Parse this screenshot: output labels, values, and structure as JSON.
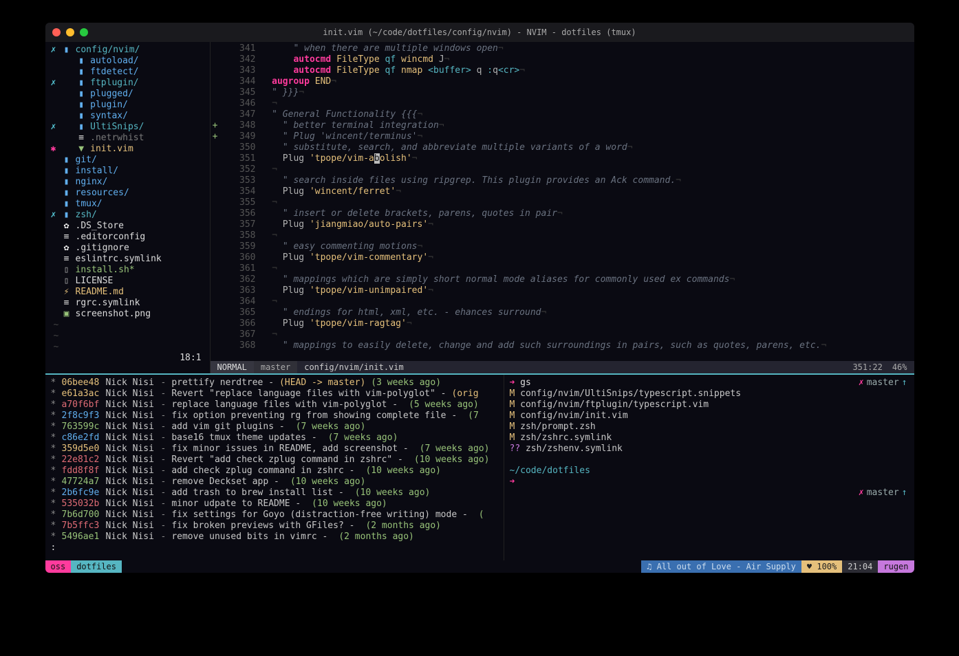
{
  "window": {
    "title": "init.vim (~/code/dotfiles/config/nvim) - NVIM - dotfiles (tmux)"
  },
  "tree": {
    "items": [
      {
        "mark": "✗",
        "icon": "folder",
        "name": "config/nvim/",
        "cls": "cyan"
      },
      {
        "mark": "",
        "icon": "folder",
        "name": "autoload/",
        "cls": "blue"
      },
      {
        "mark": "",
        "icon": "folder",
        "name": "ftdetect/",
        "cls": "blue"
      },
      {
        "mark": "✗",
        "icon": "folder",
        "name": "ftplugin/",
        "cls": "cyan"
      },
      {
        "mark": "",
        "icon": "folder",
        "name": "plugged/",
        "cls": "blue"
      },
      {
        "mark": "",
        "icon": "folder",
        "name": "plugin/",
        "cls": "blue"
      },
      {
        "mark": "",
        "icon": "folder",
        "name": "syntax/",
        "cls": "blue"
      },
      {
        "mark": "✗",
        "icon": "folder",
        "name": "UltiSnips/",
        "cls": "cyan"
      },
      {
        "mark": "",
        "icon": "doc",
        "name": ".netrwhist",
        "cls": "grey"
      },
      {
        "mark": "✱",
        "icon": "vim",
        "name": "init.vim",
        "cls": "yel"
      },
      {
        "mark": "",
        "icon": "folder",
        "name": "git/",
        "cls": "blue"
      },
      {
        "mark": "",
        "icon": "folder",
        "name": "install/",
        "cls": "blue"
      },
      {
        "mark": "",
        "icon": "folder",
        "name": "nginx/",
        "cls": "blue"
      },
      {
        "mark": "",
        "icon": "folder",
        "name": "resources/",
        "cls": "blue"
      },
      {
        "mark": "",
        "icon": "folder",
        "name": "tmux/",
        "cls": "blue"
      },
      {
        "mark": "✗",
        "icon": "folder",
        "name": "zsh/",
        "cls": "cyan"
      },
      {
        "mark": "",
        "icon": "gear",
        "name": ".DS_Store",
        "cls": "wh"
      },
      {
        "mark": "",
        "icon": "doc",
        "name": ".editorconfig",
        "cls": "wh"
      },
      {
        "mark": "",
        "icon": "gear",
        "name": ".gitignore",
        "cls": "wh"
      },
      {
        "mark": "",
        "icon": "doc",
        "name": "eslintrc.symlink",
        "cls": "wh"
      },
      {
        "mark": "",
        "icon": "file",
        "name": "install.sh*",
        "cls": "grn"
      },
      {
        "mark": "",
        "icon": "file",
        "name": "LICENSE",
        "cls": "wh"
      },
      {
        "mark": "",
        "icon": "bolt",
        "name": "README.md",
        "cls": "yel"
      },
      {
        "mark": "",
        "icon": "doc",
        "name": "rgrc.symlink",
        "cls": "wh"
      },
      {
        "mark": "",
        "icon": "img",
        "name": "screenshot.png",
        "cls": "wh"
      }
    ],
    "status": "18:1"
  },
  "code": {
    "lines": [
      {
        "n": 341,
        "html": "    <span class='cmt'>\" when there are multiple windows open</span><span class='eol'>¬</span>"
      },
      {
        "n": 342,
        "html": "    <span class='kw'>autocmd</span> <span class='fn'>FileType</span> <span class='type'>qf</span> <span class='fn'>wincmd</span> J<span class='eol'>¬</span>"
      },
      {
        "n": 343,
        "html": "    <span class='kw'>autocmd</span> <span class='fn'>FileType</span> <span class='type'>qf</span> <span class='fn'>nmap</span> <span class='ang'>&lt;buffer&gt;</span> q <span class='op'>:</span>q<span class='ang'>&lt;cr&gt;</span><span class='eol'>¬</span>"
      },
      {
        "n": 344,
        "html": "<span class='kw'>augroup</span> <span class='fn'>END</span><span class='eol'>¬</span>"
      },
      {
        "n": 345,
        "html": "<span class='cmt'>\" }}}</span><span class='eol'>¬</span>"
      },
      {
        "n": 346,
        "html": "<span class='eol'>¬</span>"
      },
      {
        "n": 347,
        "html": "<span class='cmt'>\" General Functionality {{{</span><span class='eol'>¬</span>"
      },
      {
        "n": 348,
        "sign": "+",
        "html": "  <span class='cmt'>\" better terminal integration</span><span class='eol'>¬</span>"
      },
      {
        "n": 349,
        "sign": "+",
        "html": "  <span class='cmt'>\" Plug 'wincent/terminus'</span><span class='eol'>¬</span>"
      },
      {
        "n": 350,
        "html": "  <span class='cmt'>\" substitute, search, and abbreviate multiple variants of a word</span><span class='eol'>¬</span>"
      },
      {
        "n": 351,
        "html": "  Plug <span class='str'>'tpope/vim-a<span class='cursor'>b</span>olish'</span><span class='eol'>¬</span>"
      },
      {
        "n": 352,
        "html": "<span class='eol'>¬</span>"
      },
      {
        "n": 353,
        "html": "  <span class='cmt'>\" search inside files using ripgrep. This plugin provides an Ack command.</span><span class='eol'>¬</span>"
      },
      {
        "n": 354,
        "html": "  Plug <span class='str'>'wincent/ferret'</span><span class='eol'>¬</span>"
      },
      {
        "n": 355,
        "html": "<span class='eol'>¬</span>"
      },
      {
        "n": 356,
        "html": "  <span class='cmt'>\" insert or delete brackets, parens, quotes in pair</span><span class='eol'>¬</span>"
      },
      {
        "n": 357,
        "html": "  Plug <span class='str'>'jiangmiao/auto-pairs'</span><span class='eol'>¬</span>"
      },
      {
        "n": 358,
        "html": "<span class='eol'>¬</span>"
      },
      {
        "n": 359,
        "html": "  <span class='cmt'>\" easy commenting motions</span><span class='eol'>¬</span>"
      },
      {
        "n": 360,
        "html": "  Plug <span class='str'>'tpope/vim-commentary'</span><span class='eol'>¬</span>"
      },
      {
        "n": 361,
        "html": "<span class='eol'>¬</span>"
      },
      {
        "n": 362,
        "html": "  <span class='cmt'>\" mappings which are simply short normal mode aliases for commonly used ex commands</span><span class='eol'>¬</span>"
      },
      {
        "n": 363,
        "html": "  Plug <span class='str'>'tpope/vim-unimpaired'</span><span class='eol'>¬</span>"
      },
      {
        "n": 364,
        "html": "<span class='eol'>¬</span>"
      },
      {
        "n": 365,
        "html": "  <span class='cmt'>\" endings for html, xml, etc. - ehances surround</span><span class='eol'>¬</span>"
      },
      {
        "n": 366,
        "html": "  Plug <span class='str'>'tpope/vim-ragtag'</span><span class='eol'>¬</span>"
      },
      {
        "n": 367,
        "html": "<span class='eol'>¬</span>"
      },
      {
        "n": 368,
        "html": "  <span class='cmt'>\" mappings to easily delete, change and add such surroundings in pairs, such as quotes, parens, etc.</span><span class='eol'>¬</span>"
      }
    ]
  },
  "status": {
    "mode": "NORMAL",
    "branch": "master",
    "file": "config/nvim/init.vim",
    "pos": "351:22",
    "pct": "46%",
    "apple": ""
  },
  "gitlog": [
    {
      "h": "06bee48",
      "hc": "h4",
      "a": "Nick Nisi",
      "m": "prettify nerdtree - ",
      "ref": "(HEAD -> master)",
      "age": "(3 weeks ago)"
    },
    {
      "h": "e61a3ac",
      "hc": "h4",
      "a": "Nick Nisi",
      "m": "Revert \"replace language files with vim-polyglot\" - ",
      "ref": "(orig",
      "age": ""
    },
    {
      "h": "a70f6bf",
      "hc": "h1",
      "a": "Nick Nisi",
      "m": "replace language files with vim-polyglot - ",
      "ref": "",
      "age": "(5 weeks ago)"
    },
    {
      "h": "2f8c9f3",
      "hc": "h2",
      "a": "Nick Nisi",
      "m": "fix option preventing rg from showing complete file - ",
      "ref": "",
      "age": "(7"
    },
    {
      "h": "763599c",
      "hc": "h3",
      "a": "Nick Nisi",
      "m": "add vim git plugins - ",
      "ref": "",
      "age": "(7 weeks ago)"
    },
    {
      "h": "c86e2fd",
      "hc": "h2",
      "a": "Nick Nisi",
      "m": "base16 tmux theme updates - ",
      "ref": "",
      "age": "(7 weeks ago)"
    },
    {
      "h": "359d5e0",
      "hc": "h4",
      "a": "Nick Nisi",
      "m": "fix minor issues in README, add screenshot - ",
      "ref": "",
      "age": "(7 weeks ago)"
    },
    {
      "h": "22e81c2",
      "hc": "h1",
      "a": "Nick Nisi",
      "m": "Revert \"add check zplug command in zshrc\" - ",
      "ref": "",
      "age": "(10 weeks ago)"
    },
    {
      "h": "fdd8f8f",
      "hc": "h1",
      "a": "Nick Nisi",
      "m": "add check zplug command in zshrc - ",
      "ref": "",
      "age": "(10 weeks ago)"
    },
    {
      "h": "47724a7",
      "hc": "h3",
      "a": "Nick Nisi",
      "m": "remove Deckset app - ",
      "ref": "",
      "age": "(10 weeks ago)"
    },
    {
      "h": "2b6fc9e",
      "hc": "h2",
      "a": "Nick Nisi",
      "m": "add trash to brew install list - ",
      "ref": "",
      "age": "(10 weeks ago)"
    },
    {
      "h": "535032b",
      "hc": "h1",
      "a": "Nick Nisi",
      "m": "minor udpate to README - ",
      "ref": "",
      "age": "(10 weeks ago)"
    },
    {
      "h": "7b6d700",
      "hc": "h3",
      "a": "Nick Nisi",
      "m": "fix settings for Goyo (distraction-free writing) mode - ",
      "ref": "",
      "age": "("
    },
    {
      "h": "7b5ffc3",
      "hc": "h1",
      "a": "Nick Nisi",
      "m": "fix broken previews with GFiles? - ",
      "ref": "",
      "age": "(2 months ago)"
    },
    {
      "h": "5496ae1",
      "hc": "h3",
      "a": "Nick Nisi",
      "m": "remove unused bits in vimrc - ",
      "ref": "",
      "age": "(2 months ago)"
    }
  ],
  "gitstatus": {
    "branch": "master",
    "cmd": "gs",
    "files": [
      {
        "s": "M",
        "p": "config/nvim/UltiSnips/typescript.snippets"
      },
      {
        "s": "M",
        "p": "config/nvim/ftplugin/typescript.vim"
      },
      {
        "s": "M",
        "p": "config/nvim/init.vim"
      },
      {
        "s": "M",
        "p": "zsh/prompt.zsh"
      },
      {
        "s": "M",
        "p": "zsh/zshrc.symlink"
      },
      {
        "s": "??",
        "p": "zsh/zshenv.symlink"
      }
    ],
    "cwd": "~/code/dotfiles"
  },
  "tmux": {
    "sess": "oss",
    "win": "dotfiles",
    "song": "♫ All out of Love - Air Supply",
    "batt": "♥ 100%",
    "time": "21:04",
    "host": "rugen"
  }
}
